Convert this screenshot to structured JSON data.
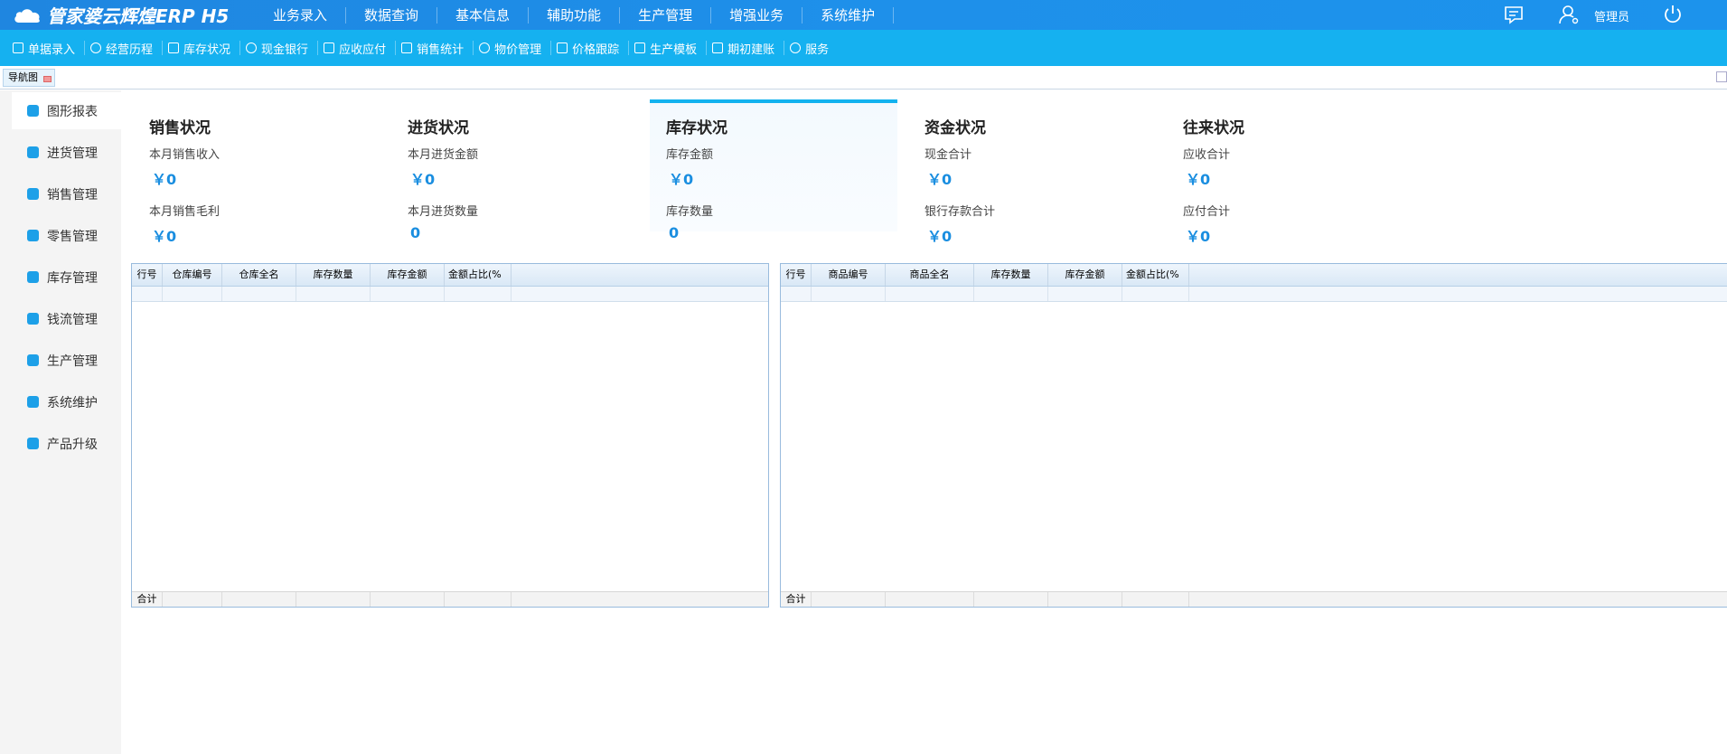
{
  "app": {
    "title": "管家婆云辉煌ERP H5"
  },
  "main_nav": [
    {
      "label": "业务录入"
    },
    {
      "label": "数据查询"
    },
    {
      "label": "基本信息"
    },
    {
      "label": "辅助功能"
    },
    {
      "label": "生产管理"
    },
    {
      "label": "增强业务"
    },
    {
      "label": "系统维护"
    }
  ],
  "user": {
    "name": "管理员",
    "icons": [
      "message-icon",
      "user-icon",
      "power-icon"
    ]
  },
  "toolbar": [
    {
      "label": "单据录入",
      "icon": "edit-icon"
    },
    {
      "label": "经营历程",
      "icon": "check-circle-icon"
    },
    {
      "label": "库存状况",
      "icon": "calendar-icon"
    },
    {
      "label": "现金银行",
      "icon": "yen-icon"
    },
    {
      "label": "应收应付",
      "icon": "exchange-icon"
    },
    {
      "label": "销售统计",
      "icon": "chart-edit-icon"
    },
    {
      "label": "物价管理",
      "icon": "yen-circle-icon"
    },
    {
      "label": "价格跟踪",
      "icon": "track-icon"
    },
    {
      "label": "生产模板",
      "icon": "template-icon"
    },
    {
      "label": "期初建账",
      "icon": "ledger-icon"
    },
    {
      "label": "服务",
      "icon": "help-icon"
    }
  ],
  "tabs": [
    {
      "label": "导航图"
    }
  ],
  "sidebar": [
    {
      "label": "图形报表",
      "icon": "line-chart-icon",
      "active": true
    },
    {
      "label": "进货管理",
      "icon": "inbox-icon"
    },
    {
      "label": "销售管理",
      "icon": "bar-chart-icon"
    },
    {
      "label": "零售管理",
      "icon": "shoe-icon"
    },
    {
      "label": "库存管理",
      "icon": "warehouse-icon"
    },
    {
      "label": "钱流管理",
      "icon": "money-icon"
    },
    {
      "label": "生产管理",
      "icon": "tools-icon"
    },
    {
      "label": "系统维护",
      "icon": "settings-icon"
    },
    {
      "label": "产品升级",
      "icon": "upgrade-icon"
    }
  ],
  "cards": [
    {
      "title": "销售状况",
      "label1": "本月销售收入",
      "value1": "￥0",
      "label2": "本月销售毛利",
      "value2": "￥0"
    },
    {
      "title": "进货状况",
      "label1": "本月进货金额",
      "value1": "￥0",
      "label2": "本月进货数量",
      "value2": "0"
    },
    {
      "title": "库存状况",
      "label1": "库存金额",
      "value1": "￥0",
      "label2": "库存数量",
      "value2": "0",
      "active": true
    },
    {
      "title": "资金状况",
      "label1": "现金合计",
      "value1": "￥0",
      "label2": "银行存款合计",
      "value2": "￥0"
    },
    {
      "title": "往来状况",
      "label1": "应收合计",
      "value1": "￥0",
      "label2": "应付合计",
      "value2": "￥0"
    }
  ],
  "grid_left": {
    "columns": [
      "行号",
      "仓库编号",
      "仓库全名",
      "库存数量",
      "库存金额",
      "金额占比(%"
    ],
    "footer": "合计"
  },
  "grid_right": {
    "columns": [
      "行号",
      "商品编号",
      "商品全名",
      "库存数量",
      "库存金额",
      "金额占比(%"
    ],
    "footer": "合计"
  },
  "colors": {
    "header_blue": "#1e8ce6",
    "toolbar_blue": "#15b1f0",
    "accent": "#1a8ee0",
    "active_border": "#12b2ef"
  }
}
